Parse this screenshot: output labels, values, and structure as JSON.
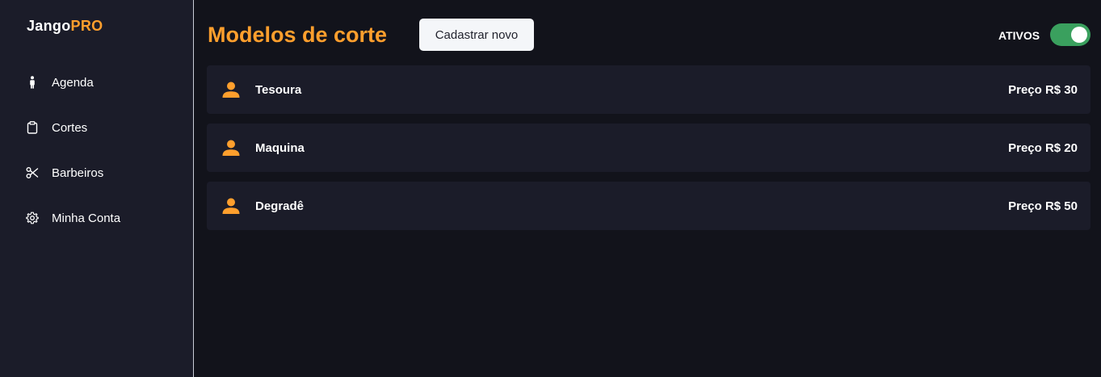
{
  "logo": {
    "base": "Jango",
    "accent": "PRO"
  },
  "sidebar": {
    "items": [
      {
        "label": "Agenda",
        "icon": "person-icon"
      },
      {
        "label": "Cortes",
        "icon": "clipboard-icon"
      },
      {
        "label": "Barbeiros",
        "icon": "scissors-icon"
      },
      {
        "label": "Minha Conta",
        "icon": "gear-icon"
      }
    ]
  },
  "header": {
    "title": "Modelos de corte",
    "new_button_label": "Cadastrar novo",
    "toggle_label": "ATIVOS",
    "toggle_on": true
  },
  "haircuts": [
    {
      "name": "Tesoura",
      "price": "Preço R$ 30",
      "icon": "user-icon"
    },
    {
      "name": "Maquina",
      "price": "Preço R$ 20",
      "icon": "user-icon"
    },
    {
      "name": "Degradê",
      "price": "Preço R$ 50",
      "icon": "user-icon"
    }
  ],
  "colors": {
    "accent": "#ff9f2d",
    "background": "#12131b",
    "panel": "#1b1c29",
    "toggle": "#3aa05e"
  }
}
